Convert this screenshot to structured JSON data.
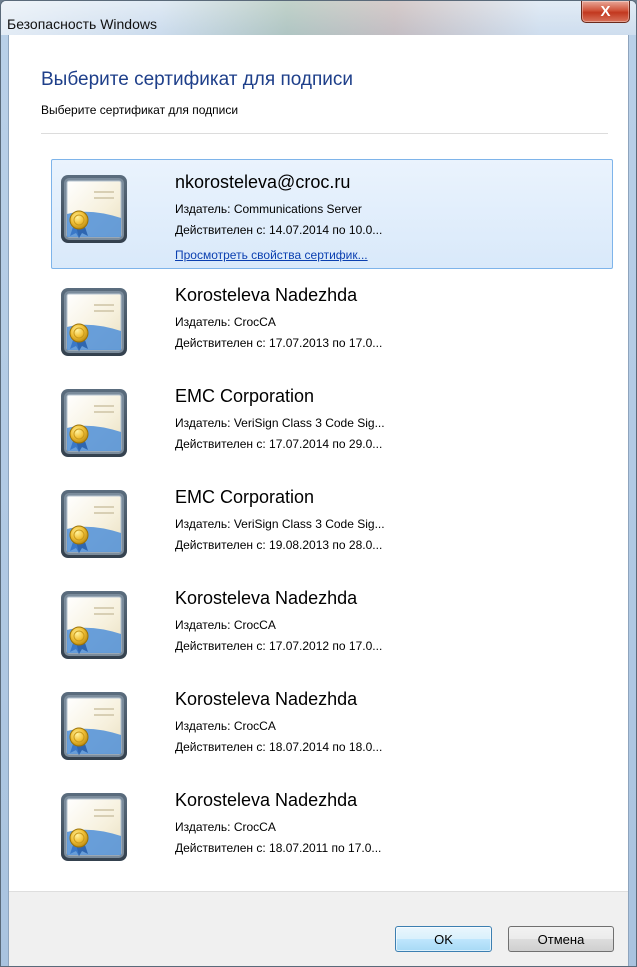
{
  "window": {
    "title": "Безопасность Windows",
    "close_glyph": "X"
  },
  "dialog": {
    "heading": "Выберите сертификат для подписи",
    "subheading": "Выберите сертификат для подписи"
  },
  "certificates": [
    {
      "name": "nkorosteleva@croc.ru",
      "issuer": "Издатель: Communications Server",
      "validity": "Действителен с: 14.07.2014 по 10.0...",
      "link": "Просмотреть свойства сертифик...",
      "selected": true
    },
    {
      "name": "Korosteleva Nadezhda",
      "issuer": "Издатель: CrocCA",
      "validity": "Действителен с: 17.07.2013 по 17.0..."
    },
    {
      "name": "EMC Corporation",
      "issuer": "Издатель: VeriSign Class 3 Code Sig...",
      "validity": "Действителен с: 17.07.2014 по 29.0..."
    },
    {
      "name": "EMC Corporation",
      "issuer": "Издатель: VeriSign Class 3 Code Sig...",
      "validity": "Действителен с: 19.08.2013 по 28.0..."
    },
    {
      "name": "Korosteleva Nadezhda",
      "issuer": "Издатель: CrocCA",
      "validity": "Действителен с: 17.07.2012 по 17.0..."
    },
    {
      "name": "Korosteleva Nadezhda",
      "issuer": "Издатель: CrocCA",
      "validity": "Действителен с: 18.07.2014 по 18.0..."
    },
    {
      "name": "Korosteleva Nadezhda",
      "issuer": "Издатель: CrocCA",
      "validity": "Действителен с: 18.07.2011 по 17.0..."
    }
  ],
  "buttons": {
    "ok": "OK",
    "cancel": "Отмена"
  },
  "icons": {
    "certificate": "certificate-icon",
    "close": "close-icon"
  },
  "colors": {
    "heading": "#1e3f8a",
    "selection_border": "#7eb4ea",
    "link": "#0b3fb0"
  }
}
